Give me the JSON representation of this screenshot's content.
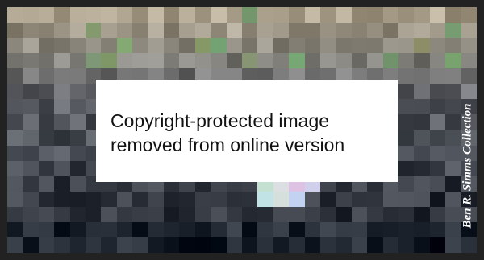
{
  "notice": {
    "line1": "Copyright-protected image",
    "line2": "removed from online version"
  },
  "credit": "Ben R. Simms Collection",
  "colors": {
    "frame": "#222222",
    "notice_bg": "#ffffff",
    "notice_text": "#111111",
    "credit_text": "#ffffff"
  }
}
